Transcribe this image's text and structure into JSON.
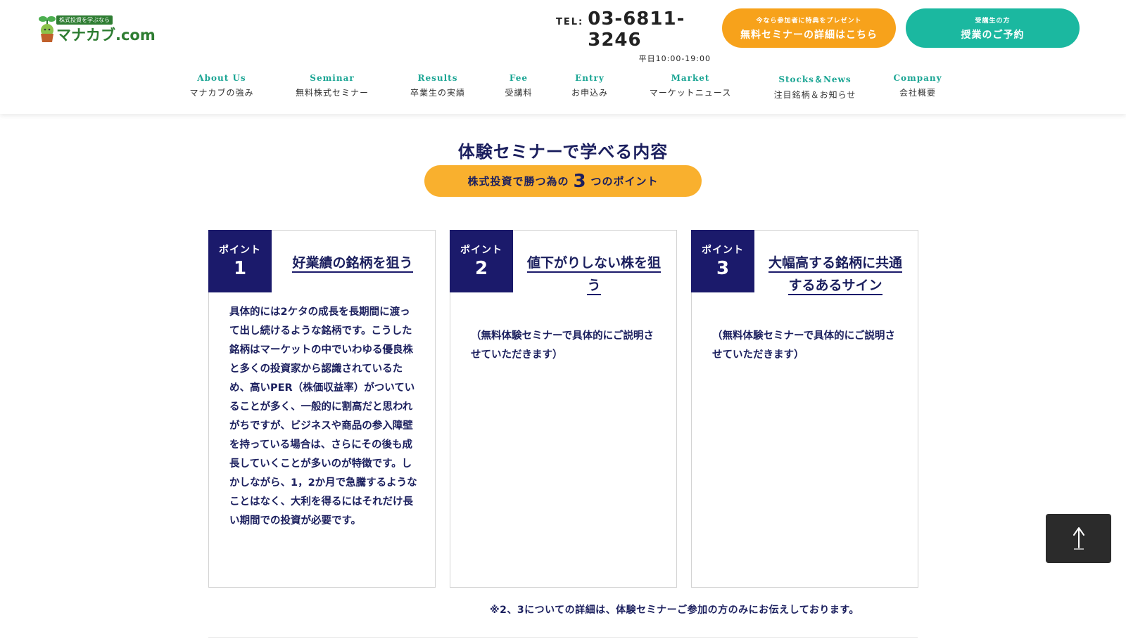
{
  "header": {
    "logo": {
      "tagline": "株式投資を学ぶなら",
      "name": "マナカブ.com"
    },
    "tel": {
      "label": "TEL:",
      "number": "03-6811-3246",
      "hours": "平日10:00-19:00"
    },
    "cta_seminar": {
      "small": "今なら参加者に特典をプレゼント",
      "big": "無料セミナーの詳細はこちら"
    },
    "cta_student": {
      "small": "受講生の方",
      "big": "授業のご予約"
    }
  },
  "nav": [
    {
      "en": "About Us",
      "ja": "マナカブの強み"
    },
    {
      "en": "Seminar",
      "ja": "無料株式セミナー"
    },
    {
      "en": "Results",
      "ja": "卒業生の実績"
    },
    {
      "en": "Fee",
      "ja": "受講料"
    },
    {
      "en": "Entry",
      "ja": "お申込み"
    },
    {
      "en": "Market",
      "ja": "マーケットニュース"
    },
    {
      "en": "Stocks＆News",
      "ja": "注目銘柄＆お知らせ"
    },
    {
      "en": "Company",
      "ja": "会社概要"
    }
  ],
  "section": {
    "title": "体験セミナーで学べる内容",
    "pill_before": "株式投資で勝つ為の",
    "pill_number": "3",
    "pill_after": "つのポイント"
  },
  "cards": [
    {
      "badge_label": "ポイント",
      "badge_num": "1",
      "title": "好業績の銘柄を狙う",
      "body": "具体的には2ケタの成長を長期間に渡って出し続けるような銘柄です。こうした銘柄はマーケットの中でいわゆる優良株と多くの投資家から認識されているため、高いPER（株価収益率）がついていることが多く、一般的に割高だと思われがちですが、ビジネスや商品の参入障壁を持っている場合は、さらにその後も成長していくことが多いのが特徴です。しかしながら、1，2か月で急騰するようなことはなく、大利を得るにはそれだけ長い期間での投資が必要です。"
    },
    {
      "badge_label": "ポイント",
      "badge_num": "2",
      "title": "値下がりしない株を狙う",
      "body": "（無料体験セミナーで具体的にご説明させていただきます）"
    },
    {
      "badge_label": "ポイント",
      "badge_num": "3",
      "title": "大幅高する銘柄に共通するあるサイン",
      "body": "（無料体験セミナーで具体的にご説明させていただきます）"
    }
  ],
  "note": "※2、3についての詳細は、体験セミナーご参加の方のみにお伝えしております。",
  "icons": {
    "to_top": "arrow-up-icon",
    "logo": "sprout-icon"
  },
  "colors": {
    "navy": "#1b1a6b",
    "orange": "#f7a21b",
    "teal": "#1bb8a0",
    "pill": "#f9b02e",
    "green": "#2e7d32"
  }
}
